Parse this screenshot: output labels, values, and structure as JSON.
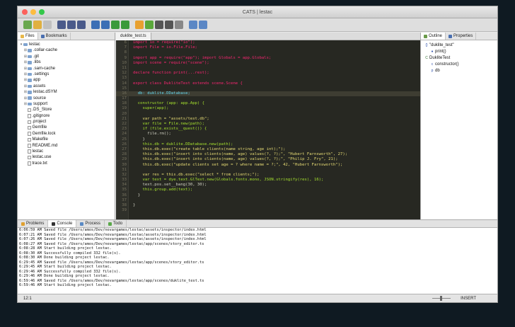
{
  "window": {
    "title": "CATS | lestac"
  },
  "toolbar": {
    "buttons": [
      {
        "icon": "new-file-icon",
        "color": "#6aa84f"
      },
      {
        "icon": "new-folder-icon",
        "color": "#e0b040"
      },
      {
        "icon": "delete-icon",
        "color": "#c0c0c0"
      },
      {
        "icon": "save-icon",
        "color": "#4a5a8a"
      },
      {
        "icon": "save-all-icon",
        "color": "#4a5a8a"
      },
      {
        "icon": "save-as-icon",
        "color": "#4a5a8a"
      },
      {
        "icon": "build-icon",
        "color": "#3b6fb5"
      },
      {
        "icon": "run-icon",
        "color": "#3b6fb5"
      },
      {
        "icon": "play-icon",
        "color": "#3a9a3a"
      },
      {
        "icon": "refresh-icon",
        "color": "#3a9a3a"
      },
      {
        "icon": "undo-icon",
        "color": "#e8a030"
      },
      {
        "icon": "redo-icon",
        "color": "#5aa83a"
      },
      {
        "icon": "find-icon",
        "color": "#555555"
      },
      {
        "icon": "replace-icon",
        "color": "#555555"
      },
      {
        "icon": "cut-icon",
        "color": "#888888"
      },
      {
        "icon": "back-icon",
        "color": "#5b87c5"
      },
      {
        "icon": "forward-icon",
        "color": "#5b87c5"
      }
    ]
  },
  "left_panel": {
    "tabs": [
      {
        "label": "Files"
      },
      {
        "label": "Bookmarks"
      }
    ],
    "tree": [
      {
        "label": "lestac",
        "kind": "root",
        "depth": 0
      },
      {
        "label": ".collar-cache",
        "kind": "folder",
        "depth": 1
      },
      {
        "label": ".git",
        "kind": "folder",
        "depth": 1
      },
      {
        "label": ".libs",
        "kind": "folder",
        "depth": 1
      },
      {
        "label": ".sam-cache",
        "kind": "folder",
        "depth": 1
      },
      {
        "label": ".settings",
        "kind": "folder",
        "depth": 1
      },
      {
        "label": "app",
        "kind": "folder",
        "depth": 1
      },
      {
        "label": "assets",
        "kind": "folder",
        "depth": 1
      },
      {
        "label": "lestac.dSYM",
        "kind": "folder",
        "depth": 1
      },
      {
        "label": "source",
        "kind": "folder",
        "depth": 1
      },
      {
        "label": "support",
        "kind": "folder",
        "depth": 1
      },
      {
        "label": ".DS_Store",
        "kind": "file",
        "depth": 1
      },
      {
        "label": ".gitignore",
        "kind": "file",
        "depth": 1
      },
      {
        "label": ".project",
        "kind": "file",
        "depth": 1
      },
      {
        "label": "Gemfile",
        "kind": "file",
        "depth": 1
      },
      {
        "label": "Gemfile.lock",
        "kind": "file",
        "depth": 1
      },
      {
        "label": "Makefile",
        "kind": "file",
        "depth": 1
      },
      {
        "label": "README.md",
        "kind": "file",
        "depth": 1
      },
      {
        "label": "lestac",
        "kind": "file",
        "depth": 1
      },
      {
        "label": "lestac.use",
        "kind": "file",
        "depth": 1
      },
      {
        "label": "trace.txt",
        "kind": "file",
        "depth": 1
      }
    ]
  },
  "editor": {
    "tab": "duklite_test.ts",
    "cursor_line": 10,
    "lines": [
      {
        "n": "6",
        "code": "import io = require(\"io\");"
      },
      {
        "n": "7",
        "code": "import File = io.File.File;"
      },
      {
        "n": "8",
        "code": ""
      },
      {
        "n": "9",
        "code": "import app = require(\"app\"); import Globals = app.Globals;"
      },
      {
        "n": "10",
        "code": "import scene = require(\"scene\");"
      },
      {
        "n": "11",
        "code": ""
      },
      {
        "n": "12",
        "code": "declare function print(...rest);"
      },
      {
        "n": "13",
        "code": ""
      },
      {
        "n": "14",
        "code": "export class DukliteTest extends scene.Scene {"
      },
      {
        "n": "15",
        "code": ""
      },
      {
        "n": "16",
        "code": "  db: duklite.DDatabase;"
      },
      {
        "n": "17",
        "code": ""
      },
      {
        "n": "18",
        "code": "  constructor (app: app.App) {"
      },
      {
        "n": "19",
        "code": "    super(app);"
      },
      {
        "n": "20",
        "code": ""
      },
      {
        "n": "21",
        "code": "    var path = \"assets/test.db\";"
      },
      {
        "n": "22",
        "code": "    var file = File.new(path);"
      },
      {
        "n": "23",
        "code": "    if (file.exists__quest()) {"
      },
      {
        "n": "24",
        "code": "      file.rm();"
      },
      {
        "n": "25",
        "code": "    }"
      },
      {
        "n": "26",
        "code": "    this.db = duklite.DDatabase.new(path);"
      },
      {
        "n": "27",
        "code": "    this.db.exec(\"create table clients(name string, age int);\");"
      },
      {
        "n": "28",
        "code": "    this.db.exec(\"insert into clients(name, age) values(?, ?);\", \"Hubert Farnsworth\", 27);"
      },
      {
        "n": "29",
        "code": "    this.db.exec(\"insert into clients(name, age) values(?, ?);\", \"Philip J. Fry\", 21);"
      },
      {
        "n": "30",
        "code": "    this.db.exec(\"update clients set age = ? where name = ?;\", 42, \"Hubert Farnsworth\");"
      },
      {
        "n": "31",
        "code": ""
      },
      {
        "n": "32",
        "code": "    var res = this.db.exec(\"select * from clients;\");"
      },
      {
        "n": "33",
        "code": "    var text = dye.text.GlText.new(Globals.fonts.mono, JSON.stringify(res), 16);"
      },
      {
        "n": "34",
        "code": "    text.pos.set__bang(30, 30);"
      },
      {
        "n": "35",
        "code": "    this.group.add(text);"
      },
      {
        "n": "36",
        "code": "  }"
      },
      {
        "n": "37",
        "code": ""
      },
      {
        "n": "38",
        "code": "}"
      },
      {
        "n": "39",
        "code": ""
      },
      {
        "n": "",
        "code": ""
      }
    ]
  },
  "right_panel": {
    "tabs": [
      {
        "label": "Outline"
      },
      {
        "label": "Properties"
      }
    ],
    "tree": [
      {
        "label": "\"duklite_test\"",
        "symbol": "{}",
        "depth": 0
      },
      {
        "label": "print()",
        "symbol": "●",
        "depth": 1
      },
      {
        "label": "DukliteTest",
        "symbol": "C",
        "depth": 0
      },
      {
        "label": "constructor()",
        "symbol": "c",
        "depth": 1
      },
      {
        "label": "db",
        "symbol": "p",
        "depth": 1
      }
    ]
  },
  "bottom_panel": {
    "tabs": [
      {
        "label": "Problems"
      },
      {
        "label": "Console"
      },
      {
        "label": "Process"
      },
      {
        "label": "Todo"
      }
    ],
    "log": [
      "6:06:59 AM Saved file /Users/amos/Dev/nevargames/lestac/assets/inspector/index.html",
      "6:07:21 AM Saved file /Users/amos/Dev/nevargames/lestac/assets/inspector/index.html",
      "6:07:26 AM Saved file /Users/amos/Dev/nevargames/lestac/assets/inspector/index.html",
      "6:08:27 AM Saved file /Users/amos/Dev/nevargames/lestac/app/scenes/story_editor.ts",
      "6:08:28 AM Start building project lestac.",
      "6:08:30 AM Successfully compiled 332 file(s).",
      "6:08:30 AM Done building project lestac.",
      "6:29:45 AM Saved file /Users/amos/Dev/nevargames/lestac/app/scenes/story_editor.ts",
      "6:29:45 AM Start building project lestac.",
      "6:29:46 AM Successfully compiled 332 file(s).",
      "6:29:46 AM Done building project lestac.",
      "6:59:46 AM Saved file /Users/amos/Dev/nevargames/lestac/app/scenes/duklite_test.ts",
      "6:59:46 AM Start building project lestac."
    ]
  },
  "status": {
    "position": "12:1",
    "mode": "INSERT"
  }
}
